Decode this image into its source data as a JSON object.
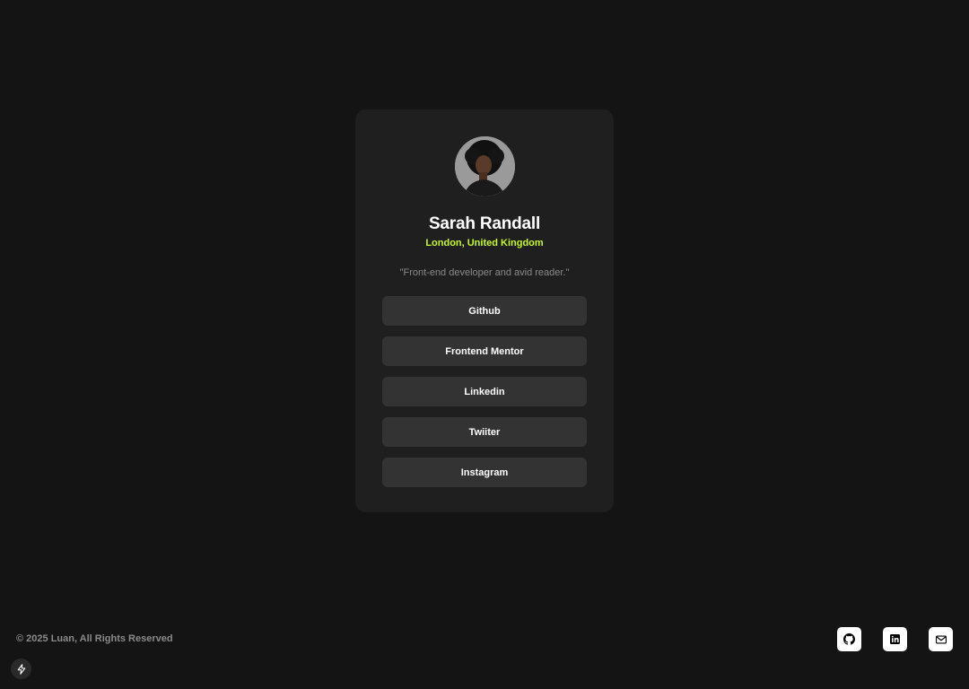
{
  "profile": {
    "name": "Sarah Randall",
    "location": "London, United Kingdom",
    "bio": "\"Front-end developer and avid reader.\""
  },
  "links": [
    {
      "label": "Github"
    },
    {
      "label": "Frontend Mentor"
    },
    {
      "label": "Linkedin"
    },
    {
      "label": "Twiiter"
    },
    {
      "label": "Instagram"
    }
  ],
  "footer": {
    "copyright": "© 2025 Luan, All Rights Reserved",
    "social_icons": [
      "github-icon",
      "linkedin-icon",
      "mail-icon"
    ]
  },
  "colors": {
    "background": "#141414",
    "card": "#1f1f1f",
    "button": "#333333",
    "accent": "#c4f82a",
    "muted": "#8a8a8a"
  }
}
